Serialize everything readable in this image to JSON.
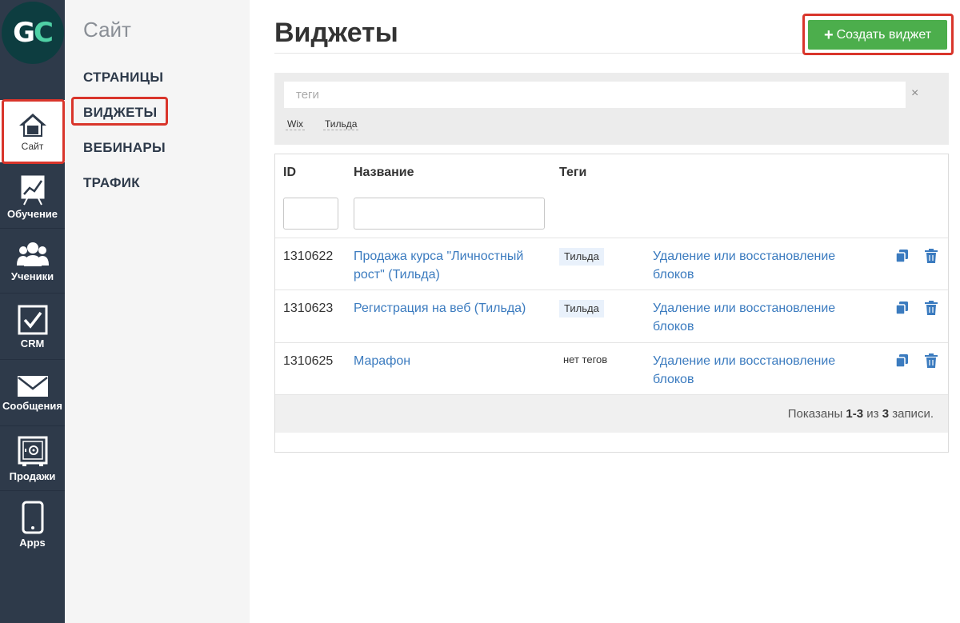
{
  "logo": {
    "text_g": "G",
    "text_c": "C"
  },
  "rail": [
    {
      "label": "Сайт",
      "icon": "home-icon",
      "active": true
    },
    {
      "label": "Обучение",
      "icon": "chart-board-icon"
    },
    {
      "label": "Ученики",
      "icon": "users-icon"
    },
    {
      "label": "CRM",
      "icon": "checkbox-icon"
    },
    {
      "label": "Сообщения",
      "icon": "envelope-icon"
    },
    {
      "label": "Продажи",
      "icon": "safe-icon"
    },
    {
      "label": "Apps",
      "icon": "phone-icon"
    }
  ],
  "sidebar": {
    "title": "Сайт",
    "links": [
      "СТРАНИЦЫ",
      "ВИДЖЕТЫ",
      "ВЕБИНАРЫ",
      "ТРАФИК"
    ],
    "active": "ВИДЖЕТЫ"
  },
  "header": {
    "title": "Виджеты",
    "create_button": "Создать виджет",
    "create_icon": "plus-icon"
  },
  "filter": {
    "tags_placeholder": "теги",
    "clear": "×",
    "tag_options": [
      "Wix",
      "Тильда"
    ]
  },
  "table": {
    "columns": [
      "ID",
      "Название",
      "Теги"
    ],
    "rows": [
      {
        "id": "1310622",
        "name": "Продажа курса \"Личностный рост\" (Тильда)",
        "tag": "Тильда",
        "link": "Удаление или восстановление блоков"
      },
      {
        "id": "1310623",
        "name": "Регистрация на веб (Тильда)",
        "tag": "Тильда",
        "link": "Удаление или восстановление блоков"
      },
      {
        "id": "1310625",
        "name": "Марафон",
        "tag": "нет тегов",
        "link": "Удаление или восстановление блоков"
      }
    ],
    "summary": {
      "prefix": "Показаны ",
      "range": "1-3",
      "middle": " из ",
      "total": "3",
      "suffix": " записи."
    }
  },
  "colors": {
    "rail_bg": "#2e3a4a",
    "accent_green": "#4cae4c",
    "link_blue": "#3b7bbf",
    "highlight_red": "#d9352b"
  }
}
